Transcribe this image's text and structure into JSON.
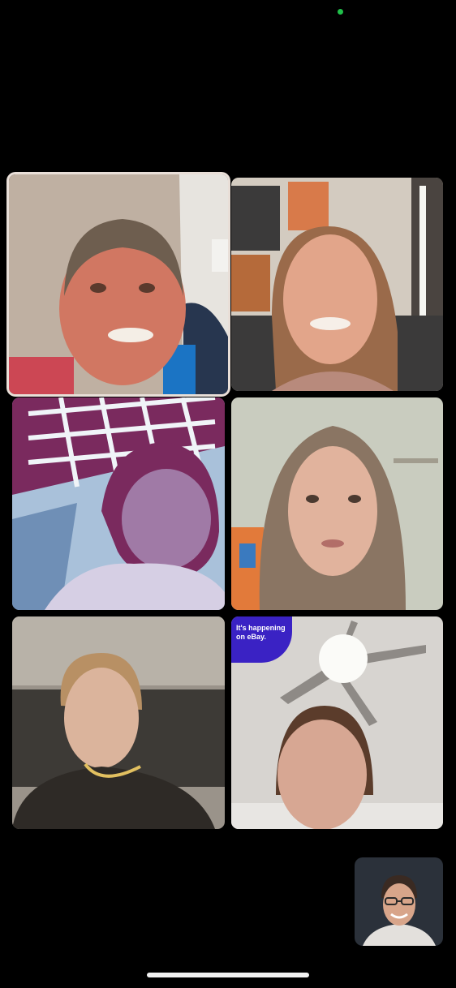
{
  "status": {
    "camera_indicator_color": "#20c04a"
  },
  "participants": [
    {
      "id": "p1",
      "active_speaker": true
    },
    {
      "id": "p2"
    },
    {
      "id": "p3",
      "filter": "comic"
    },
    {
      "id": "p4"
    },
    {
      "id": "p5"
    },
    {
      "id": "p6",
      "overlay": {
        "line1": "It's happening",
        "line2": "on eBay."
      }
    }
  ],
  "self_view": {
    "id": "self"
  }
}
